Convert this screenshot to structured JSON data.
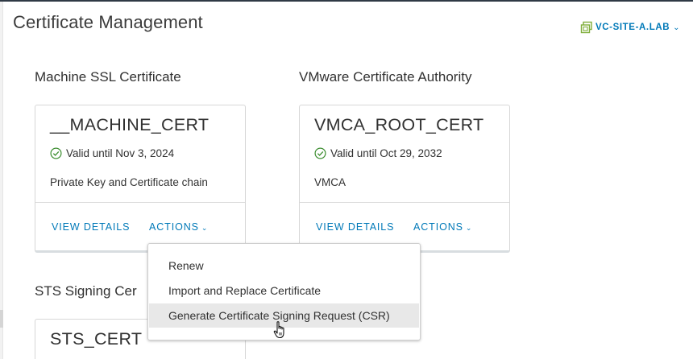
{
  "header": {
    "title": "Certificate Management",
    "site_selector": {
      "label": "VC-SITE-A.LAB",
      "icon": "vcenter-icon",
      "chevron": "chevron-down-icon"
    }
  },
  "sections": {
    "machine_ssl": {
      "title": "Machine SSL Certificate",
      "card": {
        "name": "__MACHINE_CERT",
        "status": "Valid until Nov 3, 2024",
        "status_icon": "check-circle-icon",
        "description": "Private Key and Certificate chain",
        "view_details": "VIEW DETAILS",
        "actions": "ACTIONS"
      }
    },
    "vmca": {
      "title": "VMware Certificate Authority",
      "card": {
        "name": "VMCA_ROOT_CERT",
        "status": "Valid until Oct 29, 2032",
        "status_icon": "check-circle-icon",
        "description": "VMCA",
        "view_details": "VIEW DETAILS",
        "actions": "ACTIONS"
      }
    },
    "sts": {
      "title": "STS Signing Cer",
      "card": {
        "name": "STS_CERT"
      }
    }
  },
  "actions_menu": {
    "items": [
      {
        "label": "Renew"
      },
      {
        "label": "Import and Replace Certificate"
      },
      {
        "label": "Generate Certificate Signing Request (CSR)",
        "hovered": true
      }
    ]
  },
  "colors": {
    "link": "#0079b8",
    "success": "#2e8540",
    "header_bar": "#2f3a45"
  }
}
